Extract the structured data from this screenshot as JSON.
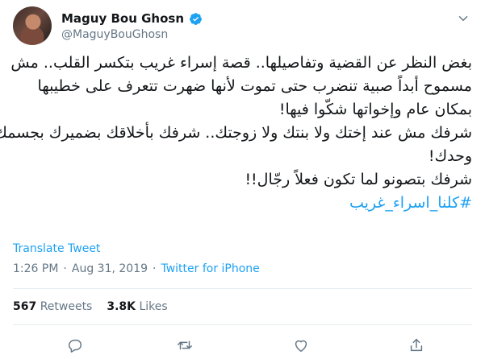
{
  "user": {
    "name": "Maguy Bou Ghosn",
    "handle": "@MaguyBouGhosn"
  },
  "tweet": {
    "lines": [
      "بغض النظر عن القضية وتفاصيلها.. قصة إسراء غريب بتكسر القلب.. مش",
      "مسموح أبداً صبية تنضرب حتى تموت لأنها ضهرت تتعرف على خطيبها",
      "بمكان عام وإخواتها شكّوا فيها!",
      "شرفك مش عند إختك ولا بنتك ولا زوجتك.. شرفك بأخلاقك بضميرك بجسمك",
      "وحدك!",
      "شرفك بتصونو لما تكون فعلاً رجّال!!"
    ],
    "hashtag": "#كلنا_اسراء_غريب"
  },
  "translate_label": "Translate Tweet",
  "meta": {
    "time": "1:26 PM",
    "sep": "·",
    "date": "Aug 31, 2019",
    "sep2": "·",
    "source": "Twitter for iPhone"
  },
  "stats": {
    "retweets_count": "567",
    "retweets_label": "Retweets",
    "likes_count": "3.8K",
    "likes_label": "Likes"
  },
  "icons": {
    "verified": "verified-badge-icon",
    "more": "chevron-down-icon",
    "reply": "reply-icon",
    "retweet": "retweet-icon",
    "like": "heart-icon",
    "share": "share-icon"
  },
  "colors": {
    "accent": "#1da1f2",
    "text": "#14171a",
    "muted": "#657786",
    "divider": "#e6ecf0"
  }
}
